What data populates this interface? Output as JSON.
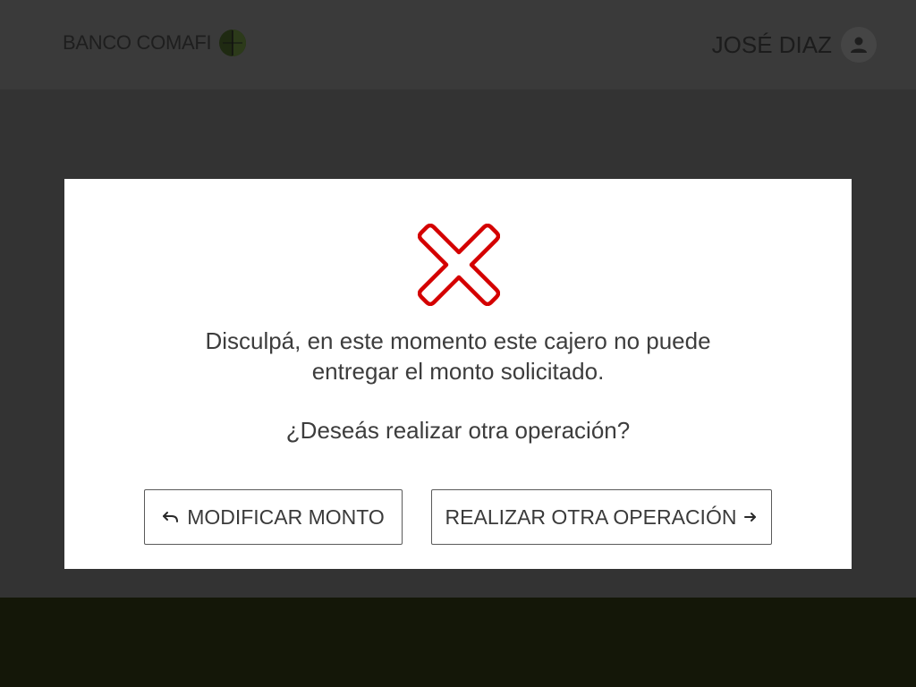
{
  "header": {
    "brand_name": "BANCO COMAFI",
    "brand_logo_icon": "comafi-logo-icon",
    "user_name": "JOSÉ DIAZ",
    "avatar_icon": "user-avatar-icon"
  },
  "modal": {
    "status_icon": "error-x-icon",
    "message_line1": "Disculpá, en este momento este cajero no puede",
    "message_line2": "entregar el monto solicitado.",
    "question": "¿Deseás realizar otra operación?",
    "buttons": {
      "modify": {
        "label": "MODIFICAR MONTO",
        "icon": "undo-icon"
      },
      "other": {
        "label": "REALIZAR OTRA OPERACIÓN",
        "icon": "arrow-right-icon"
      }
    }
  },
  "colors": {
    "overlay": "#333333",
    "header": "#3a3a3a",
    "footer": "#141708",
    "error_red": "#d40000",
    "text": "#3d3d3d"
  }
}
